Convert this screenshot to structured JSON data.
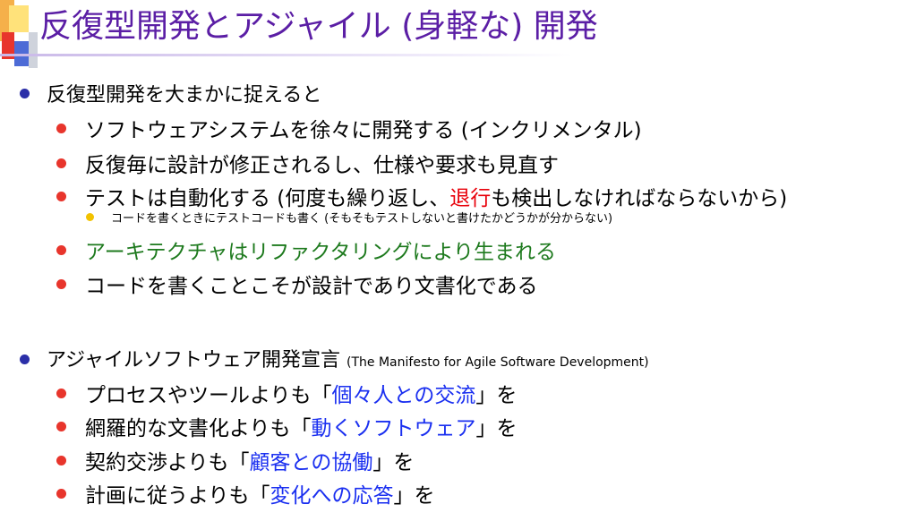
{
  "title": "反復型開発とアジャイル (身軽な) 開発",
  "section1": {
    "heading": "反復型開発を大まかに捉えると",
    "items": [
      "ソフトウェアシステムを徐々に開発する (インクリメンタル)",
      "反復毎に設計が修正されるし、仕様や要求も見直す"
    ],
    "test_item": {
      "before": "テストは自動化する (何度も繰り返し、",
      "highlight": "退行",
      "after": "も検出しなければならないから)"
    },
    "sub_note": "コードを書くときにテストコードも書く (そもそもテストしないと書けたかどうかが分からない)",
    "architecture_item": "アーキテクチャはリファクタリングにより生まれる",
    "code_item": "コードを書くことこそが設計であり文書化である"
  },
  "section2": {
    "heading": "アジャイルソフトウェア開発宣言",
    "heading_en": "(The Manifesto for Agile Software Development)",
    "items": [
      {
        "before": "プロセスやツールよりも「",
        "highlight": "個々人との交流",
        "after": "」を"
      },
      {
        "before": "網羅的な文書化よりも「",
        "highlight": "動くソフトウェア",
        "after": "」を"
      },
      {
        "before": "契約交渉よりも「",
        "highlight": "顧客との協働",
        "after": "」を"
      },
      {
        "before": "計画に従うよりも「",
        "highlight": "変化への応答",
        "after": "」を"
      }
    ]
  },
  "colors": {
    "title": "#5b1ea5",
    "bullet_level1": "#2b2fa8",
    "bullet_level2": "#e8352c",
    "bullet_level3": "#f2c200",
    "highlight_red": "#e8000a",
    "highlight_green": "#1e7a1e",
    "highlight_blue": "#1a2ff0"
  }
}
